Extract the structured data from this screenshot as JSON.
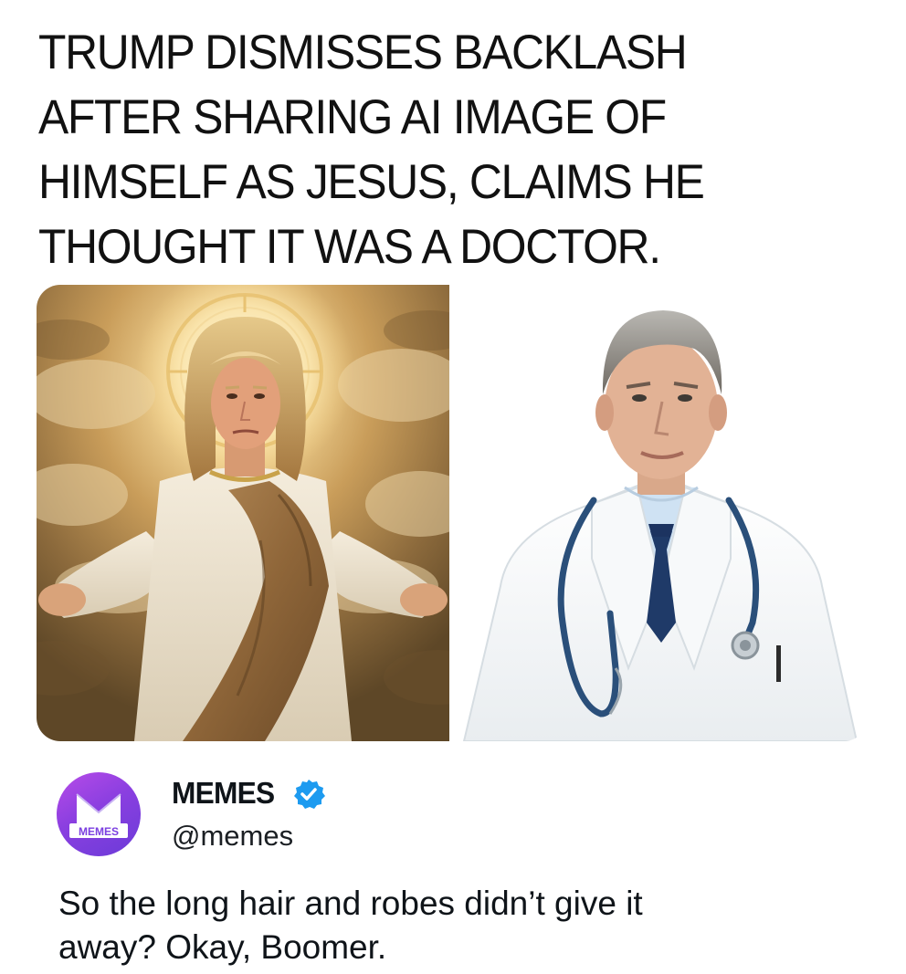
{
  "headline": {
    "lines": [
      "TRUMP DISMISSES BACKLASH",
      "AFTER SHARING AI IMAGE OF",
      "HIMSELF AS JESUS, CLAIMS HE",
      "THOUGHT IT WAS A DOCTOR."
    ]
  },
  "images": {
    "left": {
      "subject": "robed-figure-with-halo"
    },
    "right": {
      "subject": "doctor-with-stethoscope"
    }
  },
  "post": {
    "display_name": "MEMES",
    "handle": "@memes",
    "verified": true,
    "avatar_text": "MEMES",
    "avatar_color": "#8a3fe0",
    "verified_color": "#1d9bf0",
    "text_lines": [
      "So the long hair and robes didn’t give it",
      "away? Okay, Boomer."
    ]
  }
}
